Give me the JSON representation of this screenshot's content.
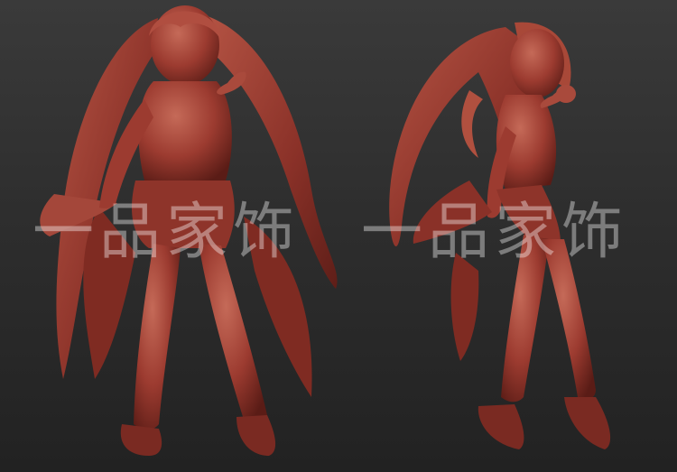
{
  "watermark": {
    "left_text": "一品家饰",
    "right_text": "一品家饰"
  },
  "colors": {
    "background_top": "#3a3a3a",
    "background_bottom": "#222222",
    "clay": "#9c3b30",
    "clay_highlight": "#c56a58",
    "clay_shadow": "#5a1c16"
  },
  "scene": {
    "subject_icon_left": "anime-figure-sculpt-front-icon",
    "subject_icon_right": "anime-figure-sculpt-side-icon"
  }
}
